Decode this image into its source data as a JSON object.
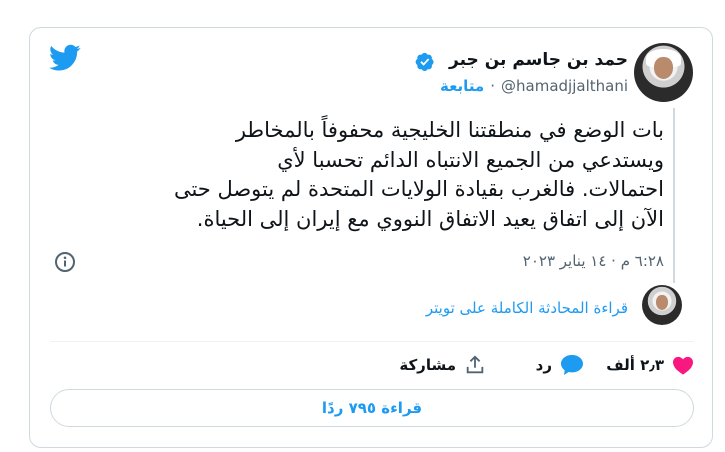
{
  "author": {
    "display_name": "حمد بن جاسم بن جبر",
    "handle": "@hamadjjalthani",
    "follow_label": "متابعة",
    "separator": "·"
  },
  "tweet": {
    "text": "بات الوضع في منطقتنا الخليجية محفوفاً بالمخاطر\nويستدعي من الجميع الانتباه الدائم تحسبا لأي\nاحتمالات. فالغرب بقيادة الولايات المتحدة لم يتوصل حتى\nالآن إلى اتفاق يعيد الاتفاق النووي مع إيران إلى الحياة.",
    "timestamp": "٦:٢٨ م · ١٤ يناير ٢٠٢٣"
  },
  "thread": {
    "read_full_label": "قراءة المحادثة الكاملة على تويتر"
  },
  "actions": {
    "like_count": "٢٫٣ ألف",
    "reply_label": "رد",
    "share_label": "مشاركة"
  },
  "replies_button": {
    "label": "قراءة ٧٩٥ ردًا"
  },
  "colors": {
    "accent": "#1d9bf0",
    "like": "#f91880",
    "text": "#0f1419",
    "muted": "#536471",
    "border": "#cfd9de"
  },
  "icons": {
    "logo": "twitter-bird-icon",
    "verified": "verified-badge-icon",
    "info": "info-icon",
    "like": "heart-icon",
    "reply": "speech-bubble-icon",
    "share": "share-icon"
  }
}
